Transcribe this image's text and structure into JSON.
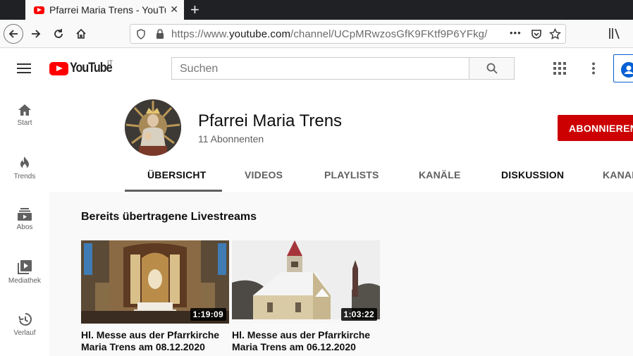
{
  "browser": {
    "tab_title": "Pfarrei Maria Trens - YouTube",
    "tab_close": "✕",
    "new_tab": "+",
    "url_prefix": "https://www.",
    "url_host": "youtube.com",
    "url_path": "/channel/UCpMRwzosGfK9FKtf9P6YFkg/",
    "url_more": "•••"
  },
  "youtube": {
    "logo_text": "YouTube",
    "logo_country": "IT",
    "search_placeholder": "Suchen"
  },
  "sidebar": {
    "items": [
      {
        "label": "Start"
      },
      {
        "label": "Trends"
      },
      {
        "label": "Abos"
      },
      {
        "label": "Mediathek"
      },
      {
        "label": "Verlauf"
      }
    ]
  },
  "channel": {
    "name": "Pfarrei Maria Trens",
    "subscribers": "11 Abonnenten",
    "subscribe_label": "ABONNIEREN",
    "tabs": [
      {
        "label": "ÜBERSICHT"
      },
      {
        "label": "VIDEOS"
      },
      {
        "label": "PLAYLISTS"
      },
      {
        "label": "KANÄLE"
      },
      {
        "label": "DISKUSSION"
      },
      {
        "label": "KANAL"
      }
    ]
  },
  "section": {
    "title": "Bereits übertragene Livestreams"
  },
  "videos": [
    {
      "title": "Hl. Messe aus der Pfarrkirche Maria Trens am 08.12.2020",
      "duration": "1:19:09"
    },
    {
      "title": "Hl. Messe aus der Pfarrkirche Maria Trens am 06.12.2020",
      "duration": "1:03:22"
    }
  ],
  "colors": {
    "brand_red": "#ff0000",
    "subscribe_red": "#cc0000",
    "account_blue": "#065fd4"
  }
}
